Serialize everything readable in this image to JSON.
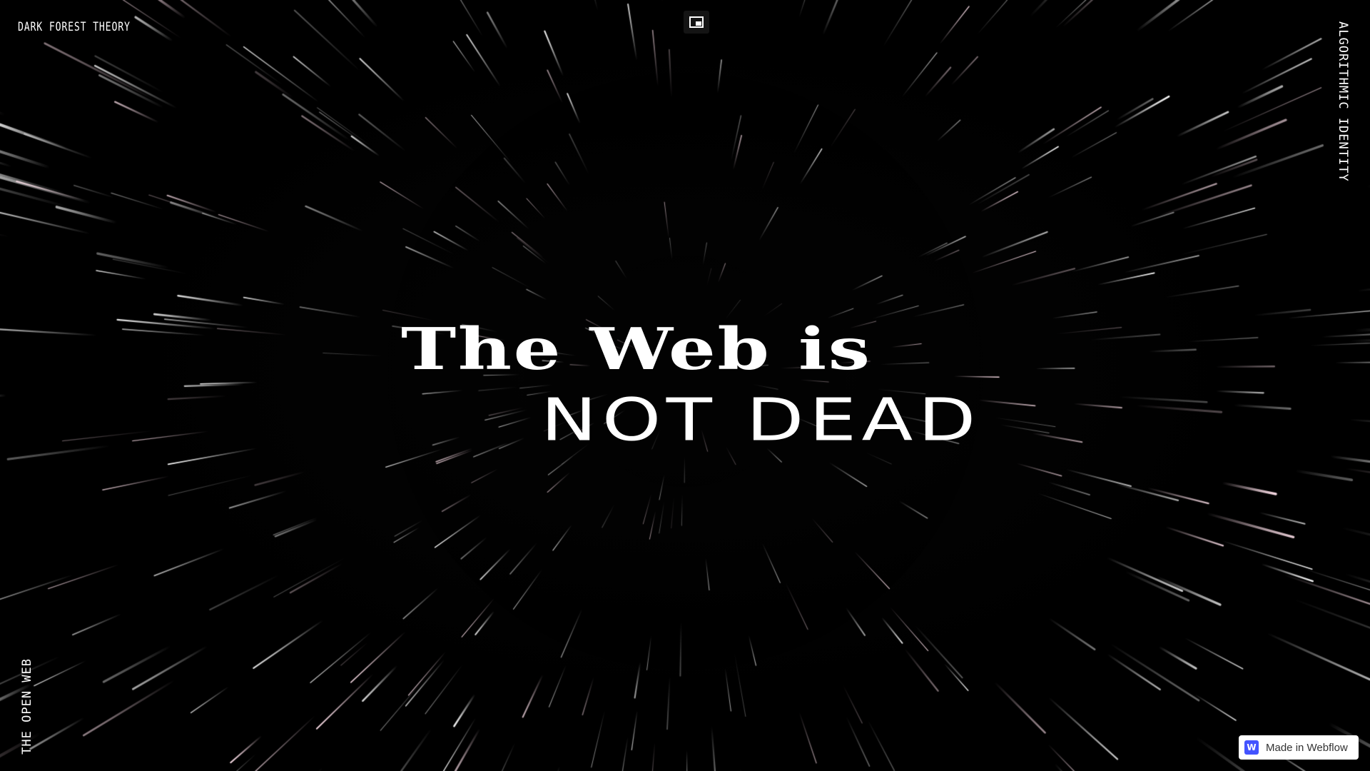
{
  "brand": {
    "label": "DARK FOREST THEORY"
  },
  "pip": {
    "icon": "picture-in-picture-icon"
  },
  "side_right": {
    "label": "ALGORITHMIC IDENTITY"
  },
  "side_left": {
    "label": "THE OPEN WEB"
  },
  "hero": {
    "line1": "The Web is",
    "line2": "NOT DEAD"
  },
  "badge": {
    "logo_letter": "W",
    "label": "Made in Webflow",
    "logo_color": "#4353ff"
  },
  "theme": {
    "background": "#000000",
    "text": "#ffffff"
  }
}
